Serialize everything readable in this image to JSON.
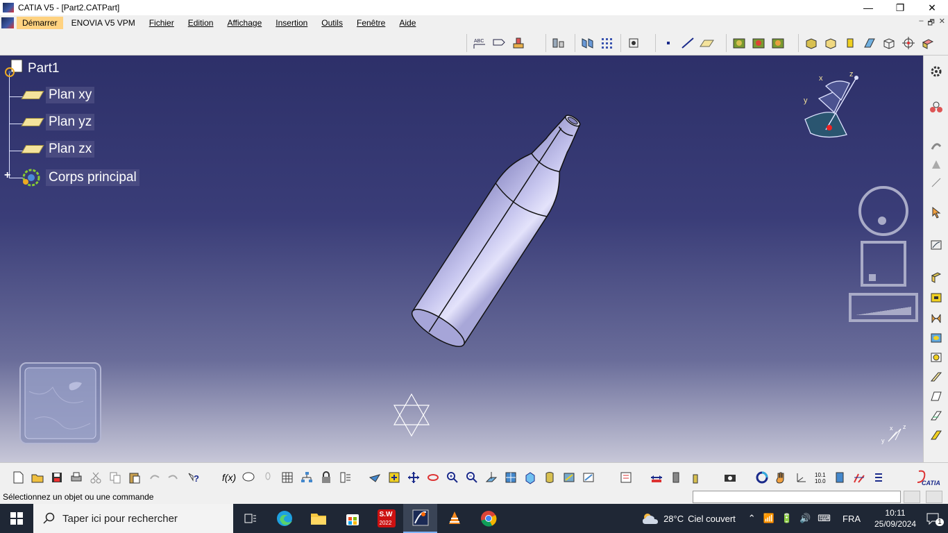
{
  "window": {
    "title": "CATIA V5 - [Part2.CATPart]",
    "minimize": "—",
    "maximize": "❐",
    "close": "✕"
  },
  "menu": {
    "items": [
      "Démarrer",
      "ENOVIA V5 VPM",
      "Fichier",
      "Edition",
      "Affichage",
      "Insertion",
      "Outils",
      "Fenêtre",
      "Aide"
    ],
    "mdi_minimize": "–",
    "mdi_restore": "🗗",
    "mdi_close": "✕"
  },
  "tree": {
    "root": "Part1",
    "children": [
      "Plan xy",
      "Plan yz",
      "Plan zx",
      "Corps principal"
    ],
    "expander": "+"
  },
  "compass": {
    "x": "x",
    "y": "y",
    "z": "z"
  },
  "small_axis": {
    "x": "x",
    "y": "y",
    "z": "z"
  },
  "status": {
    "prompt": "Sélectionnez un objet ou une commande",
    "command_value": ""
  },
  "taskbar": {
    "search_placeholder": "Taper ici pour rechercher",
    "apps": [
      "task-view",
      "edge",
      "explorer",
      "store",
      "solidworks-2022",
      "catia",
      "vlc",
      "chrome"
    ],
    "solidworks_label": "S.W",
    "solidworks_year": "2022",
    "weather_temp": "28°C",
    "weather_desc": "Ciel couvert",
    "lang": "FRA",
    "time": "10:11",
    "date": "25/09/2024",
    "notif_count": "1"
  },
  "colors": {
    "viewport_top": "#2d3069",
    "viewport_bottom": "#c7c7d8",
    "bottle": "#b9b8e6",
    "menu_active": "#ffd280",
    "taskbar": "#1f2735"
  }
}
